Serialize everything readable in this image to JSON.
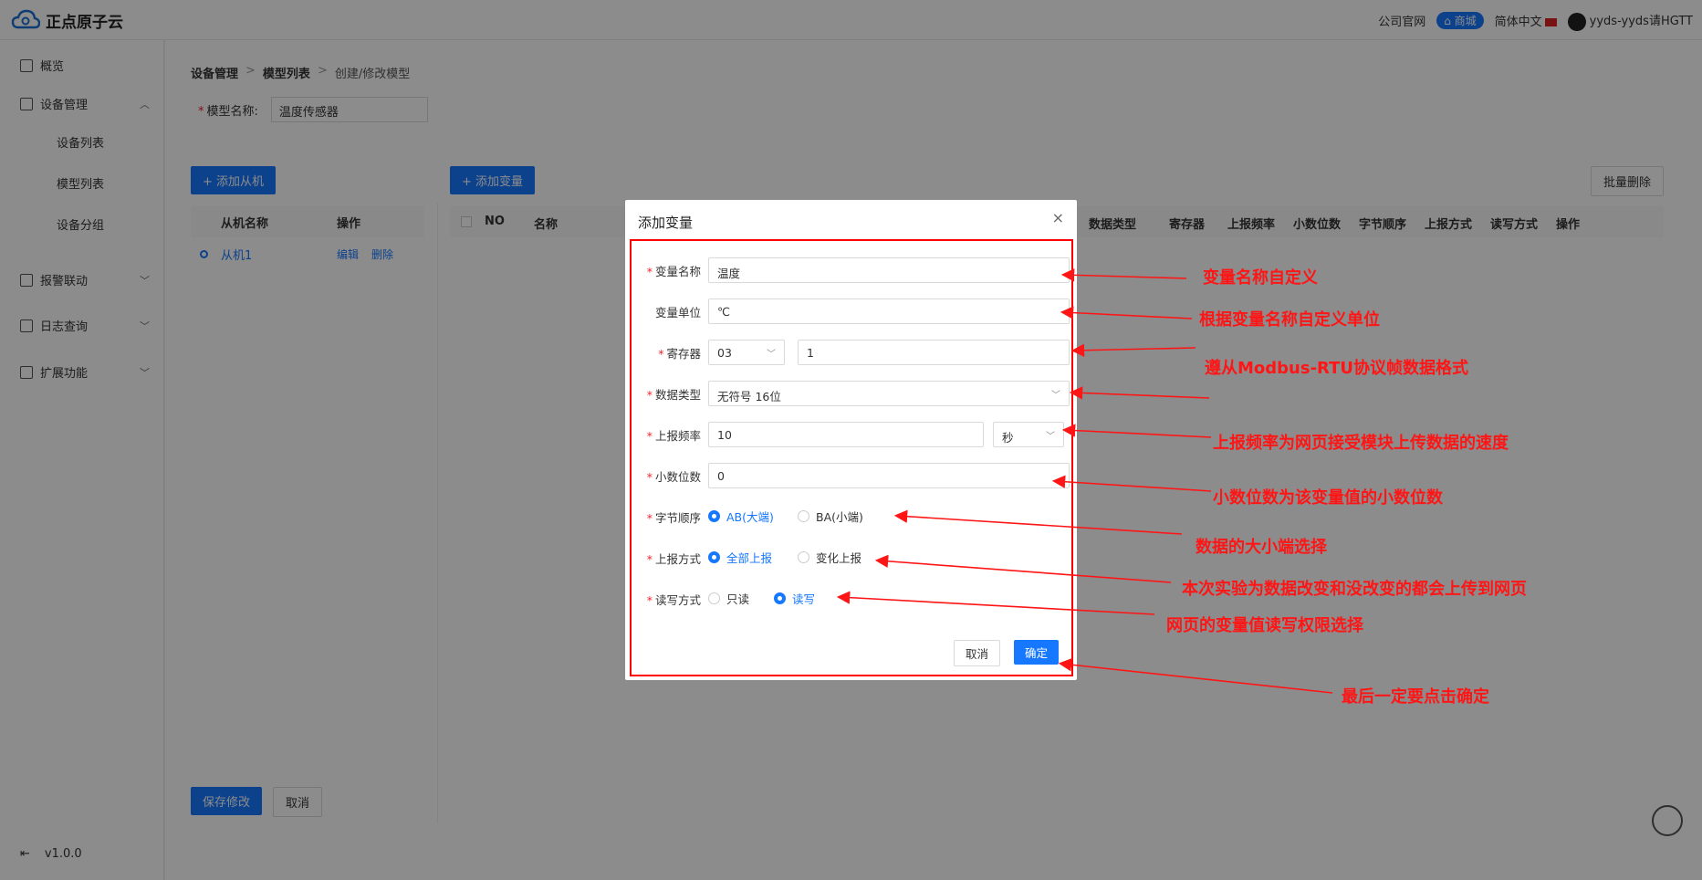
{
  "header": {
    "app_name": "正点原子云",
    "nav_company": "公司官网",
    "nav_mall": "商城",
    "nav_lang": "简体中文",
    "user": "yyds-yyds请HGTT"
  },
  "sidebar": {
    "overview": "概览",
    "device_mgmt": "设备管理",
    "device_list": "设备列表",
    "model_list": "模型列表",
    "device_group": "设备分组",
    "alarm": "报警联动",
    "log": "日志查询",
    "extension": "扩展功能",
    "version": "v1.0.0"
  },
  "breadcrumb": [
    "设备管理",
    "模型列表",
    "创建/修改模型"
  ],
  "model": {
    "label": "模型名称:",
    "value": "温度传感器"
  },
  "slave_panel": {
    "add_button": "+ 添加从机",
    "col_name": "从机名称",
    "col_op": "操作",
    "row_name": "从机1",
    "row_edit": "编辑",
    "row_delete": "删除"
  },
  "var_panel": {
    "add_button": "+ 添加变量",
    "batch_delete": "批量删除",
    "columns": [
      "NO",
      "名称",
      "数据类型",
      "寄存器",
      "上报频率",
      "小数位数",
      "字节顺序",
      "上报方式",
      "读写方式",
      "操作"
    ]
  },
  "footer": {
    "save": "保存修改",
    "cancel": "取消"
  },
  "modal": {
    "title": "添加变量",
    "close": "×",
    "fields": {
      "var_name_label": "变量名称",
      "var_name_value": "温度",
      "unit_label": "变量单位",
      "unit_value": "℃",
      "register_label": "寄存器",
      "register_type": "03",
      "register_addr": "1",
      "data_type_label": "数据类型",
      "data_type_value": "无符号 16位",
      "report_freq_label": "上报频率",
      "report_freq_value": "10",
      "report_freq_unit": "秒",
      "decimals_label": "小数位数",
      "decimals_value": "0",
      "byte_order_label": "字节顺序",
      "byte_order_ab": "AB(大端)",
      "byte_order_ba": "BA(小端)",
      "report_mode_label": "上报方式",
      "report_mode_all": "全部上报",
      "report_mode_change": "变化上报",
      "rw_label": "读写方式",
      "rw_read": "只读",
      "rw_readwrite": "读写"
    },
    "cancel": "取消",
    "confirm": "确定"
  },
  "annotations": [
    "变量名称自定义",
    "根据变量名称自定义单位",
    "遵从Modbus-RTU协议帧数据格式",
    "上报频率为网页接受模块上传数据的速度",
    "小数位数为该变量值的小数位数",
    "数据的大小端选择",
    "本次实验为数据改变和没改变的都会上传到网页",
    "网页的变量值读写权限选择",
    "最后一定要点击确定"
  ],
  "colors": {
    "primary": "#1677ff",
    "annotation": "#ff1515",
    "required": "#f5222d"
  }
}
